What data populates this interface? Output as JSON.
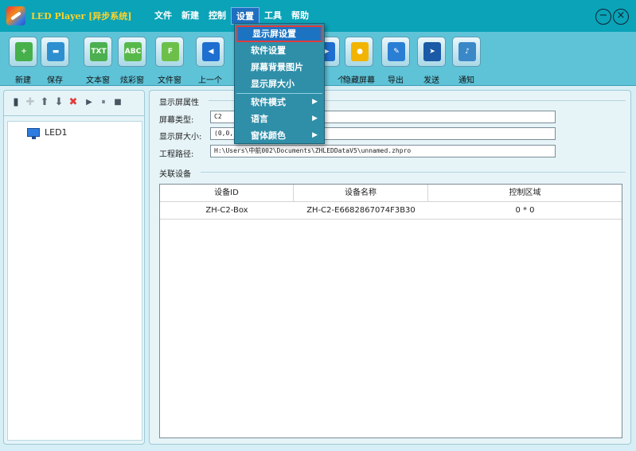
{
  "app": {
    "title": "LED Player [异步系统]"
  },
  "menubar": [
    "文件",
    "新建",
    "控制",
    "设置",
    "工具",
    "帮助"
  ],
  "window_controls": {
    "minimize": "−",
    "close": "×"
  },
  "toolbar": [
    {
      "label": "新建",
      "icon": "new-file-icon",
      "glyph": "+",
      "color": "#46b04a"
    },
    {
      "label": "保存",
      "icon": "save-icon",
      "glyph": "▬",
      "color": "#2e8fd0"
    },
    {
      "label": "文本窗",
      "icon": "text-window-icon",
      "glyph": "TXT",
      "color": "#4caf50"
    },
    {
      "label": "炫彩窗",
      "icon": "colorful-window-icon",
      "glyph": "ABC",
      "color": "#58b94a"
    },
    {
      "label": "文件窗",
      "icon": "file-window-icon",
      "glyph": "F",
      "color": "#6cc04a"
    },
    {
      "label": "上一个",
      "icon": "previous-icon",
      "glyph": "◀",
      "color": "#1e6fd0"
    },
    {
      "label": "个",
      "icon": "next-icon",
      "glyph": "▶",
      "color": "#1e6fd0"
    },
    {
      "label": "隐藏屏幕",
      "icon": "bulb-icon",
      "glyph": "●",
      "color": "#f2b400"
    },
    {
      "label": "导出",
      "icon": "export-icon",
      "glyph": "✎",
      "color": "#2a7fd4"
    },
    {
      "label": "发送",
      "icon": "send-icon",
      "glyph": "➤",
      "color": "#1a5aa6"
    },
    {
      "label": "通知",
      "icon": "notify-icon",
      "glyph": "♪",
      "color": "#3a88c8"
    }
  ],
  "tree": {
    "root": "LED1"
  },
  "display_props": {
    "group_title": "显示屏属性",
    "screen_type_label": "屏幕类型:",
    "screen_type_value": "C2",
    "screen_size_label": "显示屏大小:",
    "screen_size_value": "(0,0,",
    "project_path_label": "工程路径:",
    "project_path_value": "H:\\Users\\中航002\\Documents\\ZHLEDDataV5\\unnamed.zhpro"
  },
  "devices": {
    "group_title": "关联设备",
    "columns": [
      "设备ID",
      "设备名称",
      "控制区域"
    ],
    "rows": [
      [
        "ZH-C2-Box",
        "ZH-C2-E6682867074F3B30",
        "0 * 0"
      ]
    ]
  },
  "dropdown": {
    "items": [
      {
        "label": "显示屏设置",
        "submenu": false
      },
      {
        "label": "软件设置",
        "submenu": false
      },
      {
        "label": "屏幕背景图片",
        "submenu": false
      },
      {
        "label": "显示屏大小",
        "submenu": false
      },
      {
        "label": "软件模式",
        "submenu": true
      },
      {
        "label": "语言",
        "submenu": true
      },
      {
        "label": "窗体颜色",
        "submenu": true
      }
    ],
    "submenu_arrow": "▶"
  }
}
